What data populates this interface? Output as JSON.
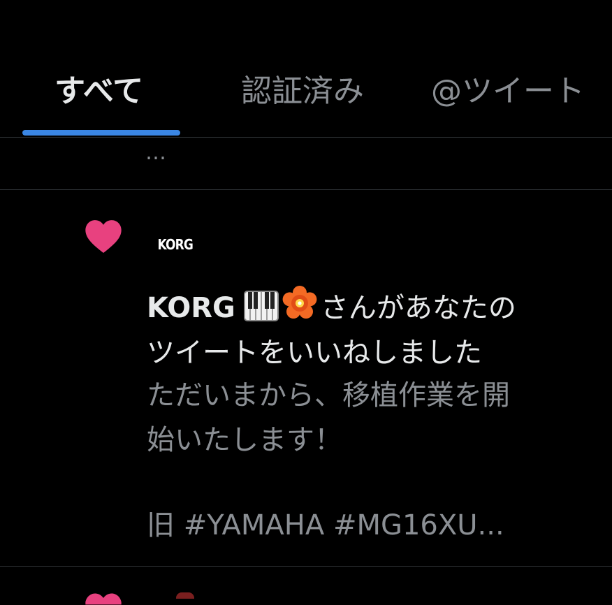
{
  "tabs": [
    {
      "label": "すべて",
      "selected": true
    },
    {
      "label": "認証済み",
      "selected": false
    },
    {
      "label": "@ツイート",
      "selected": false
    }
  ],
  "colors": {
    "accent": "#3a86e4",
    "heart": "#e8417f",
    "primary_text": "#e7e9ea",
    "secondary_text": "#8b8f94",
    "background": "#000000",
    "divider": "#2f3336"
  },
  "ellipsis": "…",
  "notification": {
    "icon": "heart-icon",
    "avatar_text": "KORG",
    "user_name": "KORG",
    "user_name_emojis": [
      "piano-keys-emoji",
      "flower-emoji"
    ],
    "action_line1": "さんがあなたの",
    "action_line2": "ツイートをいいねしました",
    "tweet_lines": [
      "ただいまから、移植作業を開",
      "始いたします！"
    ],
    "tweet_hashtags": "旧 #YAMAHA #MG16XU..."
  }
}
